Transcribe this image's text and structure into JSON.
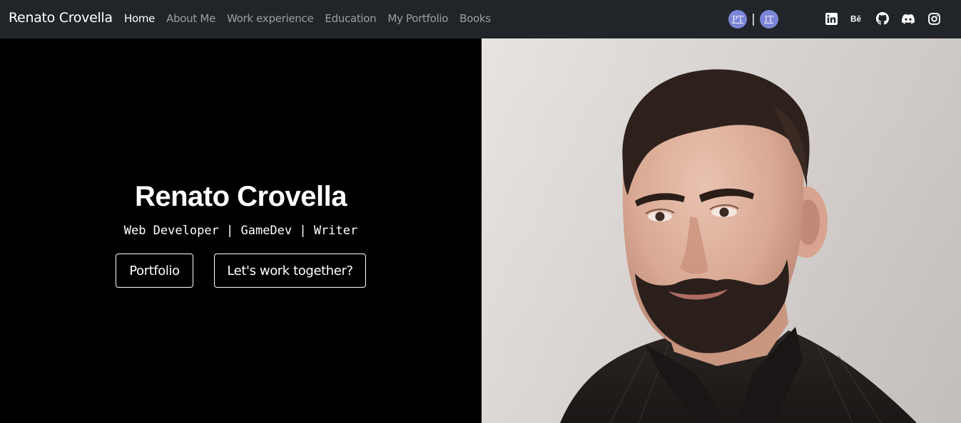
{
  "navbar": {
    "brand": "Renato Crovella",
    "links": [
      {
        "label": "Home",
        "active": true
      },
      {
        "label": "About Me",
        "active": false
      },
      {
        "label": "Work experience",
        "active": false
      },
      {
        "label": "Education",
        "active": false
      },
      {
        "label": "My Portfolio",
        "active": false
      },
      {
        "label": "Books",
        "active": false
      }
    ],
    "languages": {
      "pt": "PT",
      "separator": "|",
      "it": "IT"
    },
    "socials": [
      {
        "icon": "linkedin-icon"
      },
      {
        "icon": "behance-icon",
        "glyph": "Bē"
      },
      {
        "icon": "github-icon"
      },
      {
        "icon": "discord-icon"
      },
      {
        "icon": "instagram-icon"
      }
    ]
  },
  "hero": {
    "title": "Renato Crovella",
    "subtitle": "Web Developer | GameDev | Writer",
    "buttons": {
      "portfolio": "Portfolio",
      "work": "Let's work together?"
    }
  },
  "colors": {
    "navbar_bg": "#212529",
    "hero_bg": "#000000",
    "lang_badge": "#7b86d6",
    "nav_inactive": "rgba(255,255,255,0.55)"
  }
}
